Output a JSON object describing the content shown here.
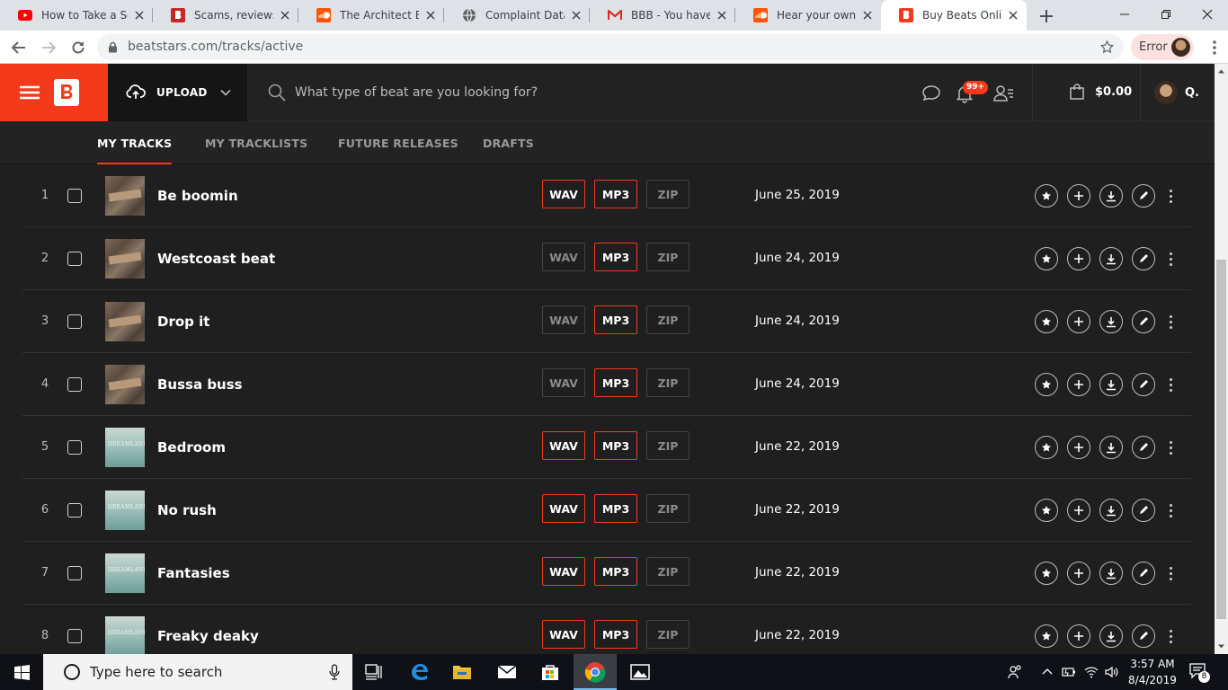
{
  "browser": {
    "tabs": [
      {
        "title": "How to Take a Screenshot",
        "icon": "youtube-icon",
        "color": "#ff0000"
      },
      {
        "title": "Scams, reviews, complaints",
        "icon": "ripoff-report-icon",
        "color": "#c62828"
      },
      {
        "title": "The Architect Beats",
        "icon": "soundcloud-icon",
        "color": "#ff5500"
      },
      {
        "title": "Complaint Data",
        "icon": "globe-icon",
        "color": "#5f6368"
      },
      {
        "title": "BBB - You have a New",
        "icon": "gmail-icon",
        "color": "#d93025"
      },
      {
        "title": "Hear your own playlists",
        "icon": "soundcloud-icon",
        "color": "#ff5500"
      },
      {
        "title": "Buy Beats Online | BeatStars",
        "icon": "beatstars-icon",
        "color": "#f33b1b"
      }
    ],
    "url": "beatstars.com/tracks/active",
    "profile_status": "Error"
  },
  "header": {
    "upload_label": "UPLOAD",
    "search_placeholder": "What type of beat are you looking for?",
    "notification_count": "99+",
    "cart_total": "$0.00",
    "user_initial": "Q.",
    "accent": "#f33b1b"
  },
  "subnav": {
    "tabs": [
      "MY TRACKS",
      "MY TRACKLISTS",
      "FUTURE RELEASES",
      "DRAFTS"
    ],
    "active": "MY TRACKS"
  },
  "formats": [
    "WAV",
    "MP3",
    "ZIP"
  ],
  "tracks": [
    {
      "num": "1",
      "title": "Be boomin",
      "date": "June 25, 2019",
      "wav": true,
      "mp3": true,
      "zip": false,
      "art": "collage"
    },
    {
      "num": "2",
      "title": "Westcoast beat",
      "date": "June 24, 2019",
      "wav": false,
      "mp3": true,
      "zip": false,
      "art": "collage"
    },
    {
      "num": "3",
      "title": "Drop it",
      "date": "June 24, 2019",
      "wav": false,
      "mp3": true,
      "zip": false,
      "art": "collage"
    },
    {
      "num": "4",
      "title": "Bussa buss",
      "date": "June 24, 2019",
      "wav": false,
      "mp3": true,
      "zip": false,
      "art": "collage"
    },
    {
      "num": "5",
      "title": "Bedroom",
      "date": "June 22, 2019",
      "wav": true,
      "mp3": true,
      "zip": false,
      "art": "dreamland"
    },
    {
      "num": "6",
      "title": "No rush",
      "date": "June 22, 2019",
      "wav": true,
      "mp3": true,
      "zip": false,
      "art": "dreamland"
    },
    {
      "num": "7",
      "title": "Fantasies",
      "date": "June 22, 2019",
      "wav": true,
      "mp3": true,
      "zip": false,
      "art": "dreamland"
    },
    {
      "num": "8",
      "title": "Freaky deaky",
      "date": "June 22, 2019",
      "wav": true,
      "mp3": true,
      "zip": false,
      "art": "dreamland"
    }
  ],
  "art_text": "DREAMLAND",
  "taskbar": {
    "search_placeholder": "Type here to search",
    "time": "3:57 AM",
    "date": "8/4/2019",
    "notification_count": "8"
  }
}
